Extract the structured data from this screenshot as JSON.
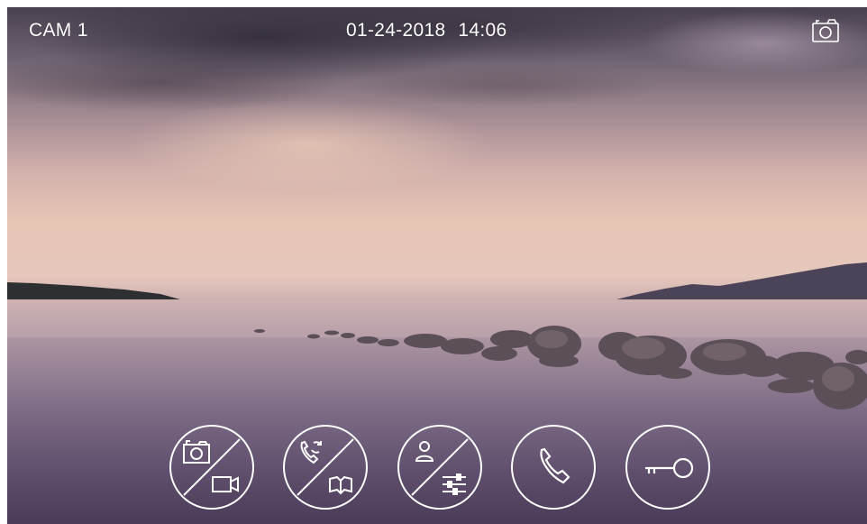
{
  "header": {
    "camera_label": "CAM 1",
    "date": "01-24-2018",
    "time": "14:06"
  },
  "icons": {
    "top_right": "camera-icon",
    "controls": [
      {
        "name": "photo-video-toggle",
        "icons": [
          "camera-icon",
          "video-camera-icon"
        ]
      },
      {
        "name": "intercom-monitor-toggle",
        "icons": [
          "call-transfer-icon",
          "book-icon"
        ]
      },
      {
        "name": "user-settings-toggle",
        "icons": [
          "user-icon",
          "sliders-icon"
        ]
      },
      {
        "name": "call",
        "icons": [
          "phone-icon"
        ]
      },
      {
        "name": "unlock",
        "icons": [
          "key-icon"
        ]
      }
    ]
  },
  "colors": {
    "overlay_text": "#ffffff"
  }
}
